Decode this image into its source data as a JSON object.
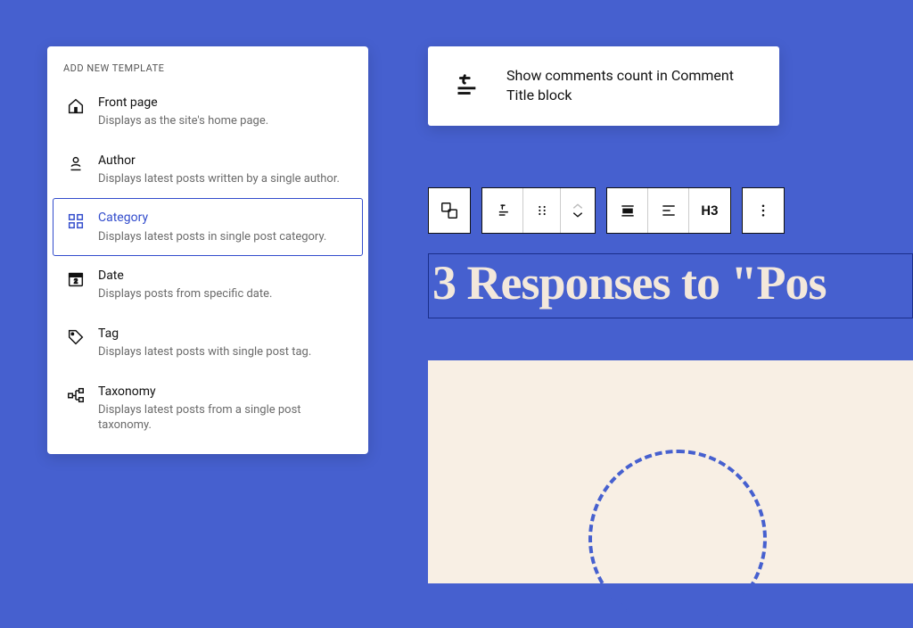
{
  "templatePanel": {
    "heading": "ADD NEW TEMPLATE",
    "items": [
      {
        "label": "Front page",
        "desc": "Displays as the site's home page."
      },
      {
        "label": "Author",
        "desc": "Displays latest posts written by a single author."
      },
      {
        "label": "Category",
        "desc": "Displays latest posts in single post category."
      },
      {
        "label": "Date",
        "desc": "Displays posts from specific date."
      },
      {
        "label": "Tag",
        "desc": "Displays latest posts with single post tag."
      },
      {
        "label": "Taxonomy",
        "desc": "Displays latest posts from a single post taxonomy."
      }
    ]
  },
  "commentCard": {
    "text": "Show comments count in Comment Title block"
  },
  "toolbar": {
    "headingLevel": "H3"
  },
  "headingBanner": {
    "text": "3 Responses to \"Pos"
  }
}
